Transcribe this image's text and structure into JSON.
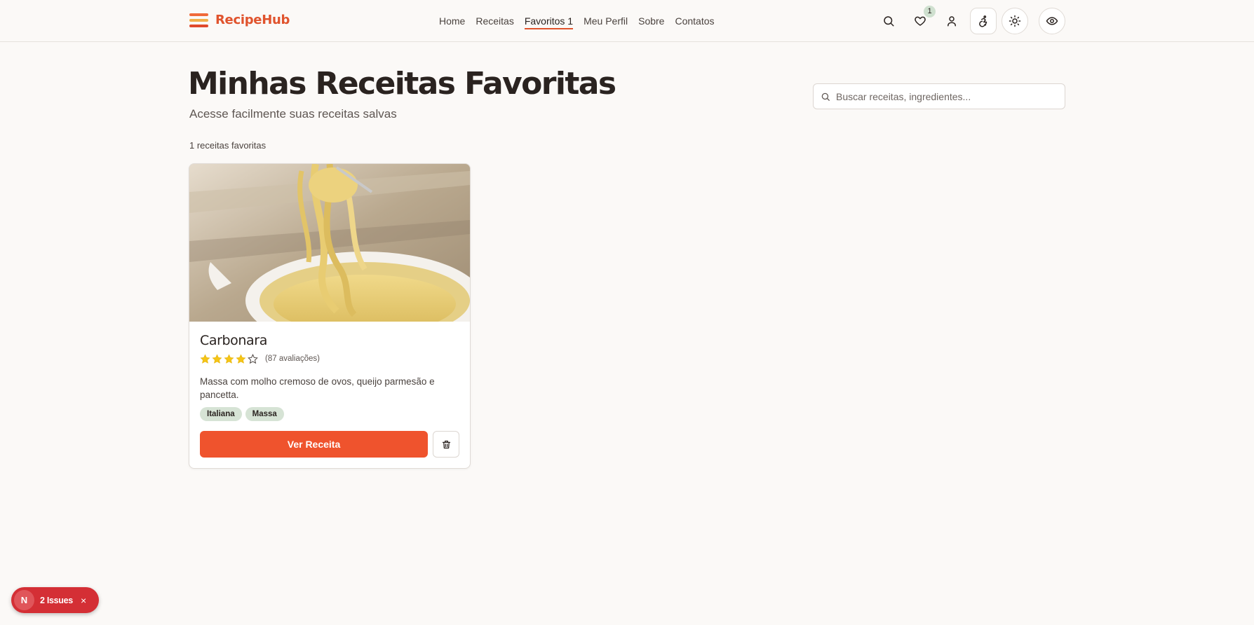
{
  "header": {
    "brand": "RecipeHub",
    "nav": [
      {
        "label": "Home"
      },
      {
        "label": "Receitas"
      },
      {
        "label": "Favoritos 1",
        "active": true
      },
      {
        "label": "Meu Perfil"
      },
      {
        "label": "Sobre"
      },
      {
        "label": "Contatos"
      }
    ],
    "favorites_badge": "1",
    "icons": [
      "search-icon",
      "heart-icon",
      "user-icon",
      "accessibility-icon",
      "sun-icon",
      "eye-icon"
    ]
  },
  "main": {
    "title": "Minhas Receitas Favoritas",
    "subtitle": "Acesse facilmente suas receitas salvas",
    "count_text": "1 receitas favoritas",
    "search": {
      "placeholder": "Buscar receitas, ingredientes..."
    }
  },
  "recipes": [
    {
      "title": "Carbonara",
      "rating": 4,
      "max_rating": 5,
      "reviews": "(87 avaliações)",
      "description": "Massa com molho cremoso de ovos, queijo parmesão e pancetta.",
      "tags": [
        "Italiana",
        "Massa"
      ],
      "view_label": "Ver Receita"
    }
  ],
  "dev_overlay": {
    "logo": "N",
    "label": "2 Issues",
    "close": "×"
  },
  "colors": {
    "accent": "#ef532d",
    "brand": "#e0532d",
    "tag_bg": "#d6e3d5",
    "star": "#f5c518",
    "issues_bg": "#d42f35"
  }
}
